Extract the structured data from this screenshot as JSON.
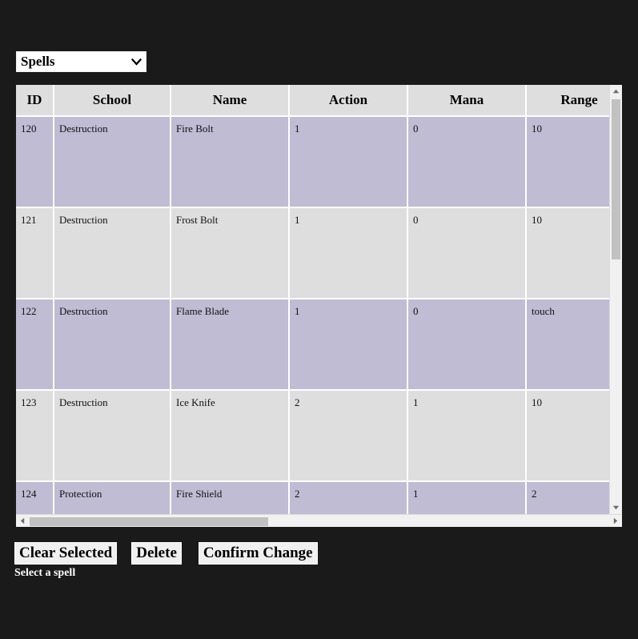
{
  "selector": {
    "name": "entity-type-select",
    "selected": "Spells",
    "options": [
      "Spells"
    ],
    "arrow_icon": "chevron-down-icon"
  },
  "table": {
    "columns": [
      "ID",
      "School",
      "Name",
      "Action",
      "Mana",
      "Range"
    ],
    "rows": [
      {
        "id": "120",
        "school": "Destruction",
        "name": "Fire Bolt",
        "action": "1",
        "mana": "0",
        "range": "10"
      },
      {
        "id": "121",
        "school": "Destruction",
        "name": "Frost Bolt",
        "action": "1",
        "mana": "0",
        "range": "10"
      },
      {
        "id": "122",
        "school": "Destruction",
        "name": "Flame Blade",
        "action": "1",
        "mana": "0",
        "range": "touch"
      },
      {
        "id": "123",
        "school": "Destruction",
        "name": "Ice Knife",
        "action": "2",
        "mana": "1",
        "range": "10"
      },
      {
        "id": "124",
        "school": "Protection",
        "name": "Fire Shield",
        "action": "2",
        "mana": "1",
        "range": "2"
      }
    ]
  },
  "scrollbars": {
    "vertical": {
      "up_icon": "scroll-up-arrow-icon",
      "down_icon": "scroll-down-arrow-icon"
    },
    "horizontal": {
      "left_icon": "scroll-left-arrow-icon",
      "right_icon": "scroll-right-arrow-icon"
    }
  },
  "actions": {
    "clear_selected": "Clear Selected",
    "delete": "Delete",
    "confirm_change": "Confirm Change"
  },
  "status": {
    "message": "Select a spell"
  },
  "colors": {
    "page_background": "#1a1a1a",
    "row_highlight": "#bfbcd4",
    "row_plain": "#dedede",
    "header_background": "#dedede",
    "button_face": "#f0f0f0",
    "status_text": "#ffffff"
  }
}
